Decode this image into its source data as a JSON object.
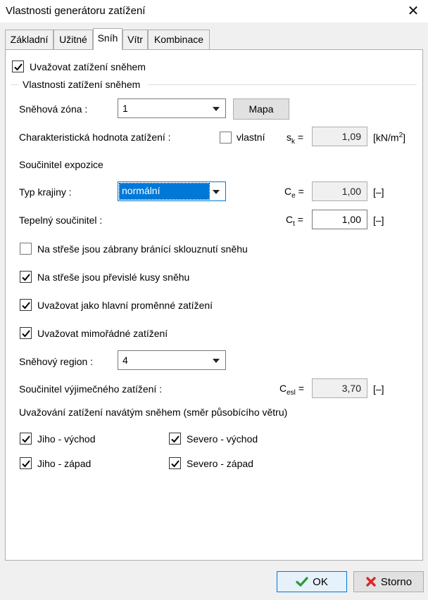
{
  "window": {
    "title": "Vlastnosti generátoru zatížení",
    "close_glyph": "✕"
  },
  "tabs": [
    {
      "label": "Základní",
      "active": false
    },
    {
      "label": "Užitné",
      "active": false
    },
    {
      "label": "Sníh",
      "active": true
    },
    {
      "label": "Vítr",
      "active": false
    },
    {
      "label": "Kombinace",
      "active": false
    }
  ],
  "snow": {
    "consider_label": "Uvažovat zatížení sněhem",
    "consider_checked": true,
    "group_title": "Vlastnosti zatížení sněhem",
    "zone_label": "Sněhová zóna :",
    "zone_value": "1",
    "map_button": "Mapa",
    "char_label": "Charakteristická hodnota zatížení :",
    "custom_label": "vlastní",
    "custom_checked": false,
    "sk_symbol": "s",
    "sk_sub": "k",
    "eq": "=",
    "sk_value": "1,09",
    "sk_unit_base": "[kN/m",
    "sk_unit_sup": "2",
    "sk_unit_end": "]",
    "exposure_heading": "Součinitel expozice",
    "landscape_label": "Typ krajiny :",
    "landscape_value": "normální",
    "ce_symbol": "C",
    "ce_sub": "e",
    "ce_value": "1,00",
    "ce_unit": "[–]",
    "thermal_label": "Tepelný součinitel :",
    "ct_symbol": "C",
    "ct_sub": "t",
    "ct_value": "1,00",
    "ct_unit": "[–]",
    "barriers_label": "Na střeše jsou zábrany bránící sklouznutí sněhu",
    "barriers_checked": false,
    "overhang_label": "Na střeše jsou převislé kusy sněhu",
    "overhang_checked": true,
    "main_variable_label": "Uvažovat jako hlavní proměnné zatížení",
    "main_variable_checked": true,
    "exceptional_label": "Uvažovat mimořádné zatížení",
    "exceptional_checked": true,
    "region_label": "Sněhový region :",
    "region_value": "4",
    "cesl_label": "Součinitel výjimečného zatížení :",
    "cesl_symbol": "C",
    "cesl_sub": "esl",
    "cesl_value": "3,70",
    "cesl_unit": "[–]",
    "drift_heading": "Uvažování zatížení navátým sněhem (směr působícího větru)",
    "drift": {
      "south_east": "Jiho - východ",
      "north_east": "Severo - východ",
      "south_west": "Jiho - západ",
      "north_west": "Severo - západ"
    }
  },
  "buttons": {
    "ok": "OK",
    "cancel": "Storno"
  },
  "colors": {
    "accent": "#0078d7",
    "ok_check": "#2e9a3a",
    "cancel_x": "#d42a2a"
  }
}
